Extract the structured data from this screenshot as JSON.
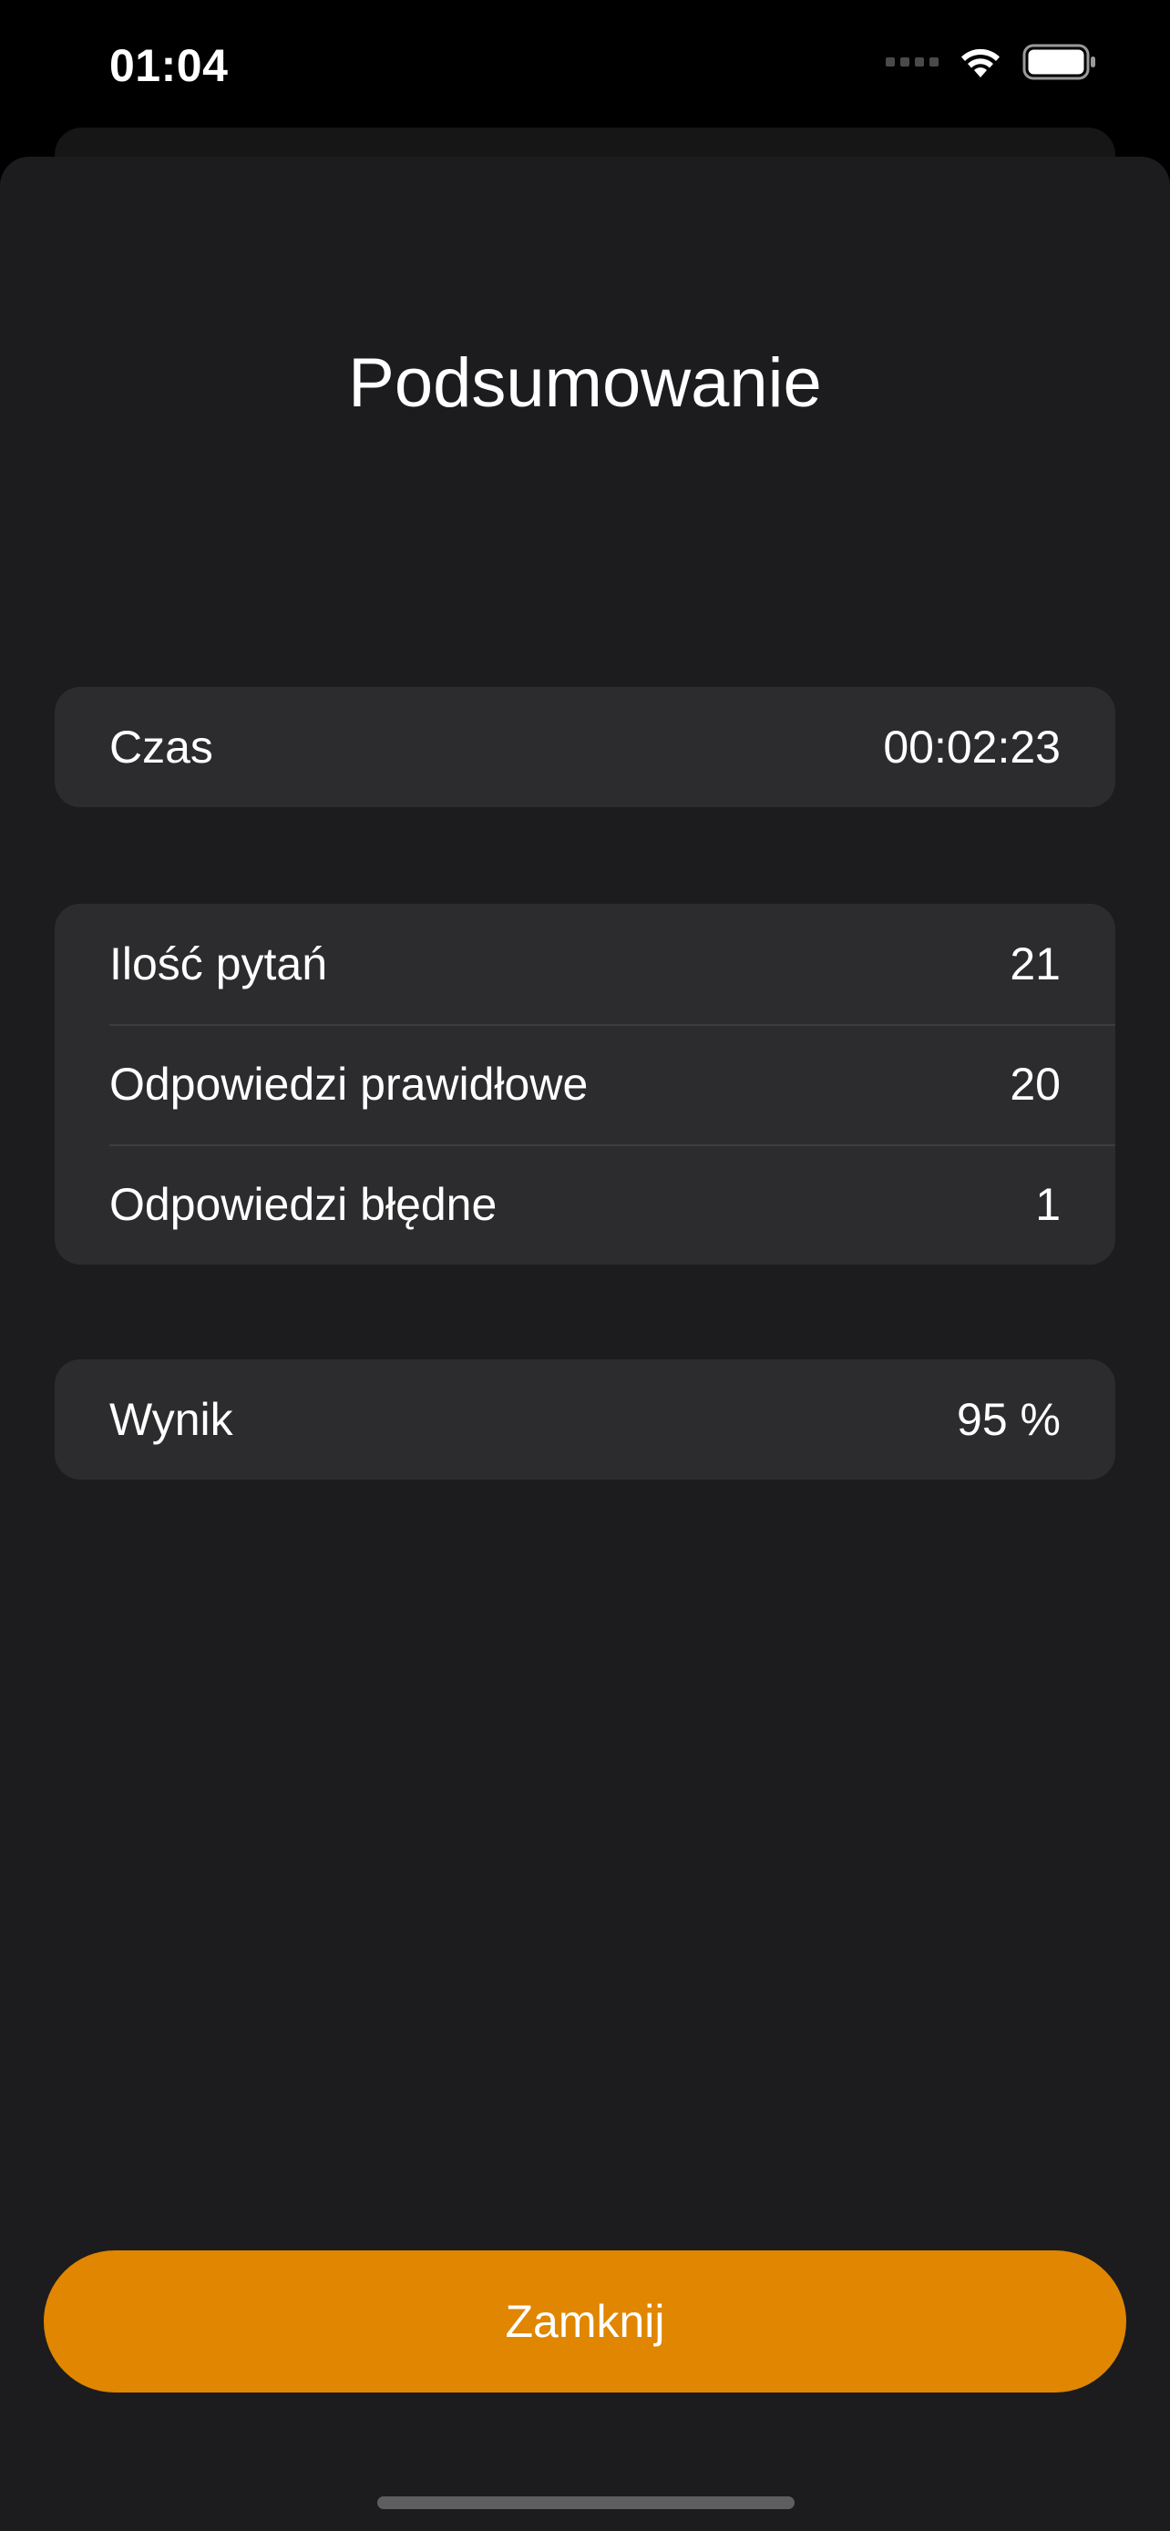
{
  "status_bar": {
    "time": "01:04",
    "icons": [
      "cellular-signal-icon",
      "wifi-icon",
      "battery-icon"
    ]
  },
  "summary": {
    "title": "Podsumowanie",
    "time_group": {
      "label": "Czas",
      "value": "00:02:23"
    },
    "questions_group": [
      {
        "label": "Ilość pytań",
        "value": "21"
      },
      {
        "label": "Odpowiedzi prawidłowe",
        "value": "20"
      },
      {
        "label": "Odpowiedzi błędne",
        "value": "1"
      }
    ],
    "result_group": {
      "label": "Wynik",
      "value": "95 %"
    }
  },
  "actions": {
    "close_label": "Zamknij"
  },
  "colors": {
    "accent": "#E08600",
    "background": "#1C1C1E",
    "card": "#2C2C2E"
  }
}
